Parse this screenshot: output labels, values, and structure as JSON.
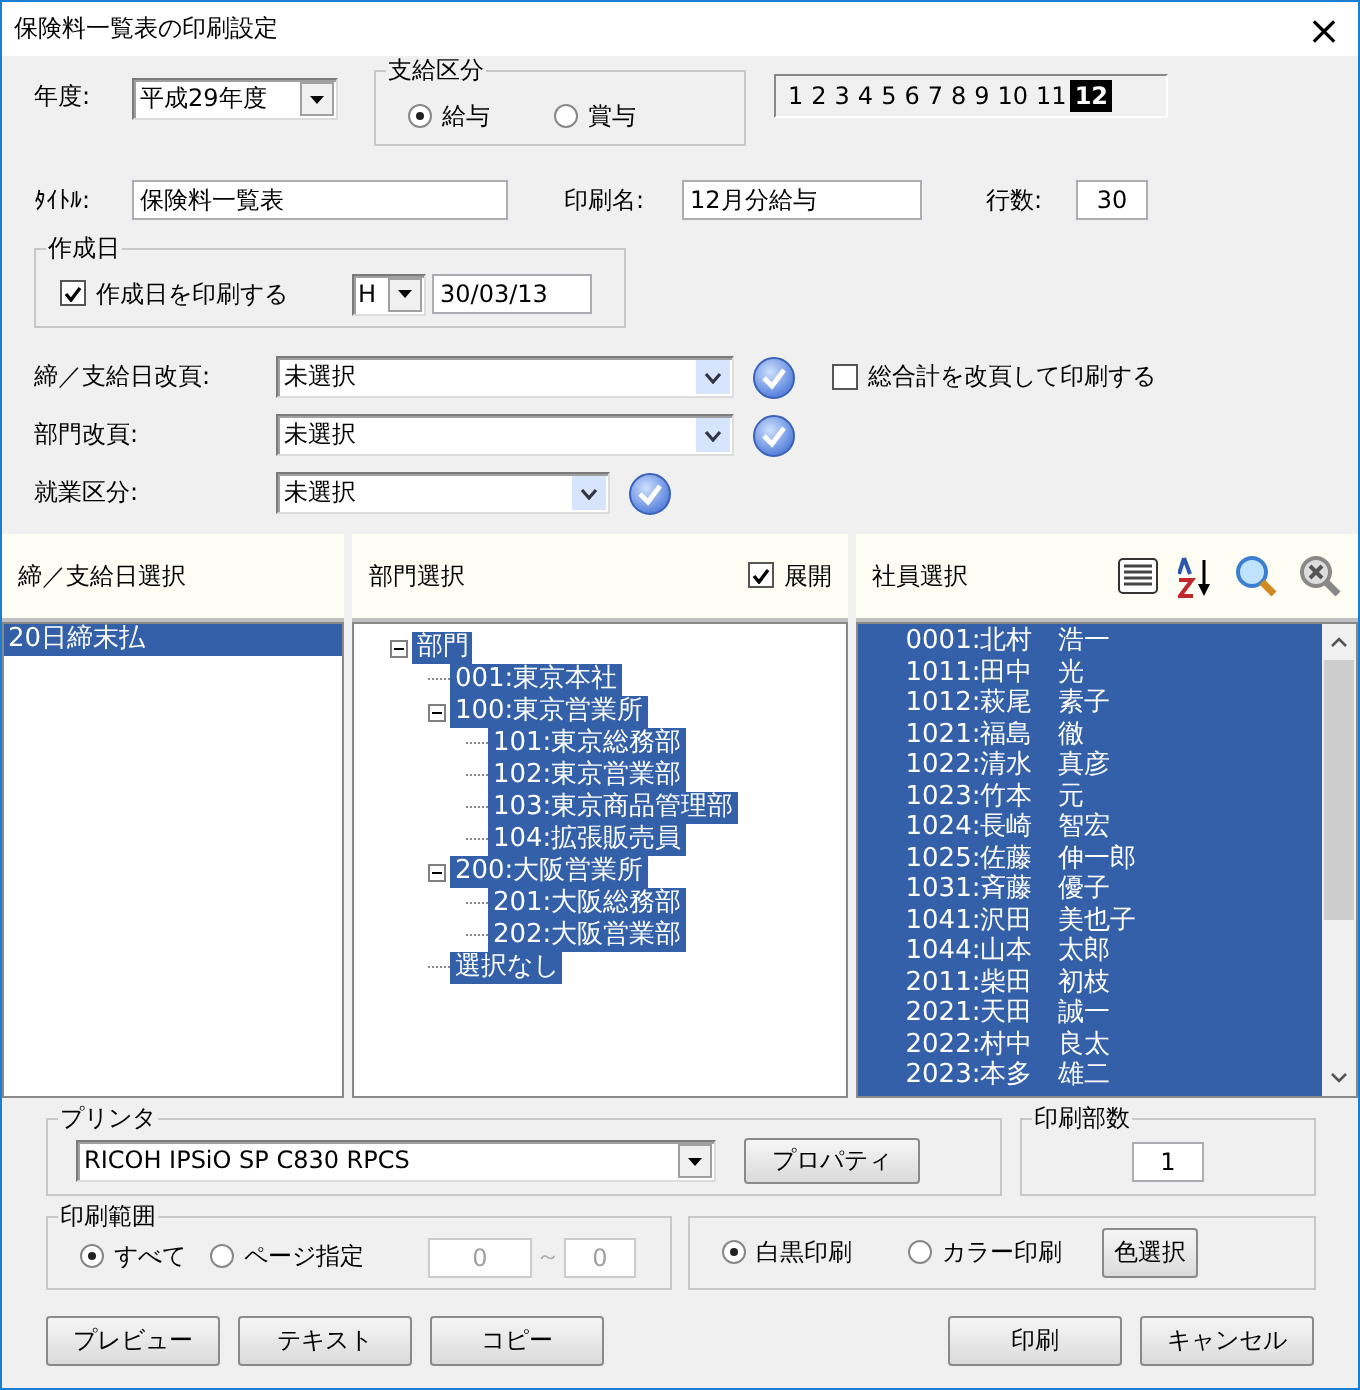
{
  "window": {
    "title": "保険料一覧表の印刷設定",
    "close": "×"
  },
  "fiscal_year": {
    "label": "年度:",
    "value": "平成29年度"
  },
  "pay_type": {
    "legend": "支給区分",
    "options": [
      {
        "label": "給与",
        "selected": true
      },
      {
        "label": "賞与",
        "selected": false
      }
    ]
  },
  "months": [
    {
      "label": "1",
      "selected": false
    },
    {
      "label": "2",
      "selected": false
    },
    {
      "label": "3",
      "selected": false
    },
    {
      "label": "4",
      "selected": false
    },
    {
      "label": "5",
      "selected": false
    },
    {
      "label": "6",
      "selected": false
    },
    {
      "label": "7",
      "selected": false
    },
    {
      "label": "8",
      "selected": false
    },
    {
      "label": "9",
      "selected": false
    },
    {
      "label": "10",
      "selected": false
    },
    {
      "label": "11",
      "selected": false
    },
    {
      "label": "12",
      "selected": true
    }
  ],
  "title_field": {
    "label": "ﾀｲﾄﾙ:",
    "value": "保険料一覧表"
  },
  "print_name": {
    "label": "印刷名:",
    "value": "12月分給与"
  },
  "row_count": {
    "label": "行数:",
    "value": "30"
  },
  "created": {
    "legend": "作成日",
    "checkbox": {
      "label": "作成日を印刷する",
      "checked": true
    },
    "era": "H",
    "date": "30/03/13"
  },
  "page_breaks": [
    {
      "label": "締／支給日改頁:",
      "value": "未選択",
      "wide": true
    },
    {
      "label": "部門改頁:",
      "value": "未選択",
      "wide": true
    },
    {
      "label": "就業区分:",
      "value": "未選択",
      "wide": false
    }
  ],
  "grand_total": {
    "label": "総合計を改頁して印刷する",
    "checked": false
  },
  "closing_dates": {
    "header": "締／支給日選択",
    "items": [
      {
        "label": "20日締末払",
        "selected": true
      }
    ]
  },
  "departments": {
    "header": "部門選択",
    "expand": {
      "label": "展開",
      "checked": true
    },
    "tree": [
      {
        "label": "部門",
        "selected": true,
        "expanded": true,
        "children": [
          {
            "label": "001:東京本社",
            "selected": true
          },
          {
            "label": "100:東京営業所",
            "selected": true,
            "expanded": true,
            "children": [
              {
                "label": "101:東京総務部",
                "selected": true
              },
              {
                "label": "102:東京営業部",
                "selected": true
              },
              {
                "label": "103:東京商品管理部",
                "selected": true
              },
              {
                "label": "104:拡張販売員",
                "selected": true
              }
            ]
          },
          {
            "label": "200:大阪営業所",
            "selected": true,
            "expanded": true,
            "children": [
              {
                "label": "201:大阪総務部",
                "selected": true
              },
              {
                "label": "202:大阪営業部",
                "selected": true
              }
            ]
          },
          {
            "label": "選択なし",
            "selected": true
          }
        ]
      }
    ]
  },
  "employees": {
    "header": "社員選択",
    "items": [
      {
        "label": "0001:北村　浩一",
        "selected": true
      },
      {
        "label": "1011:田中　光",
        "selected": true
      },
      {
        "label": "1012:萩尾　素子",
        "selected": true
      },
      {
        "label": "1021:福島　徹",
        "selected": true
      },
      {
        "label": "1022:清水　真彦",
        "selected": true
      },
      {
        "label": "1023:竹本　元",
        "selected": true
      },
      {
        "label": "1024:長崎　智宏",
        "selected": true
      },
      {
        "label": "1025:佐藤　伸一郎",
        "selected": true
      },
      {
        "label": "1031:斉藤　優子",
        "selected": true
      },
      {
        "label": "1041:沢田　美也子",
        "selected": true
      },
      {
        "label": "1044:山本　太郎",
        "selected": true
      },
      {
        "label": "2011:柴田　初枝",
        "selected": true
      },
      {
        "label": "2021:天田　誠一",
        "selected": true
      },
      {
        "label": "2022:村中　良太",
        "selected": true
      },
      {
        "label": "2023:本多　雄二",
        "selected": true
      }
    ]
  },
  "printer": {
    "legend": "プリンタ",
    "value": "RICOH IPSiO SP C830 RPCS",
    "button": "プロパティ"
  },
  "copies": {
    "legend": "印刷部数",
    "value": "1"
  },
  "range": {
    "legend": "印刷範囲",
    "options": [
      {
        "label": "すべて",
        "selected": true
      },
      {
        "label": "ページ指定",
        "selected": false
      }
    ],
    "from": {
      "value": "0",
      "disabled": true
    },
    "separator": "～",
    "to": {
      "value": "0",
      "disabled": true
    }
  },
  "color_mode": {
    "options": [
      {
        "label": "白黒印刷",
        "selected": true
      },
      {
        "label": "カラー印刷",
        "selected": false
      }
    ],
    "button": "色選択"
  },
  "buttons_left": [
    "プレビュー",
    "テキスト",
    "コピー"
  ],
  "buttons_right": [
    "印刷",
    "キャンセル"
  ]
}
